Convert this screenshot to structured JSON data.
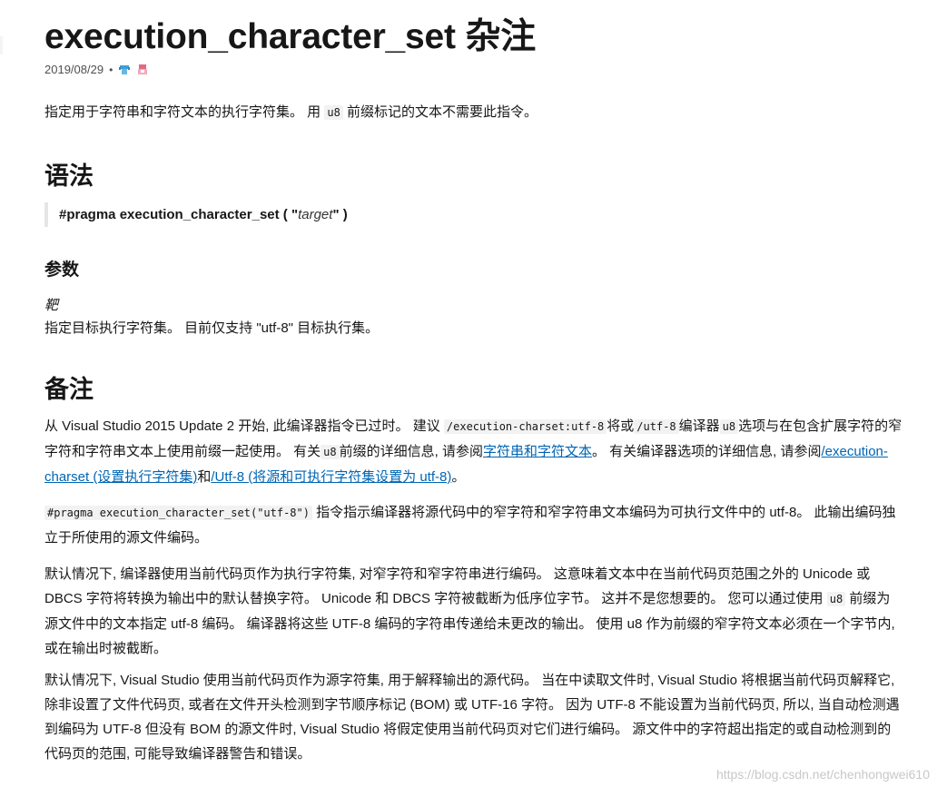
{
  "title": "execution_character_set 杂注",
  "meta": {
    "date": "2019/08/29",
    "separator": "•",
    "contributors": [
      "contributor-avatar-1",
      "contributor-avatar-2"
    ]
  },
  "intro": {
    "before": "指定用于字符串和字符文本的执行字符集。 用",
    "code": "u8",
    "after": " 前缀标记的文本不需要此指令。"
  },
  "syntax": {
    "heading": "语法",
    "pragma": "#pragma execution_character_set",
    "open": " ( \"",
    "target": "target",
    "close": "\" )"
  },
  "params": {
    "heading": "参数",
    "name": "靶",
    "desc": "指定目标执行字符集。 目前仅支持 \"utf-8\" 目标执行集。"
  },
  "remarks": {
    "heading": "备注",
    "p1": {
      "t1": "从 Visual Studio 2015 Update 2 开始, 此编译器指令已过时。 建议",
      "c1": "/execution-charset:utf-8",
      "t2": "将或",
      "c2": "/utf-8",
      "t3": "编译器",
      "c3": "u8",
      "t4": "选项与在包含扩展字符的窄字符和字符串文本上使用前缀一起使用。 有关",
      "c4": "u8",
      "t5": "前缀的详细信息, 请参阅",
      "link1": "字符串和字符文本",
      "t6": "。 有关编译器选项的详细信息, 请参阅",
      "link2": "/execution-charset (设置执行字符集)",
      "t7": "和",
      "link3": "/Utf-8 (将源和可执行字符集设置为 utf-8)",
      "t8": "。"
    },
    "p2": {
      "code": "#pragma execution_character_set(\"utf-8\")",
      "text": "指令指示编译器将源代码中的窄字符和窄字符串文本编码为可执行文件中的 utf-8。 此输出编码独立于所使用的源文件编码。"
    },
    "p3": {
      "t1": "默认情况下, 编译器使用当前代码页作为执行字符集, 对窄字符和窄字符串进行编码。 这意味着文本中在当前代码页范围之外的 Unicode 或 DBCS 字符将转换为输出中的默认替换字符。 Unicode 和 DBCS 字符被截断为低序位字节。 这并不是您想要的。 您可以通过使用",
      "code": "u8",
      "t2": "前缀为源文件中的文本指定 utf-8 编码。 编译器将这些 UTF-8 编码的字符串传递给未更改的输出。 使用 u8 作为前缀的窄字符文本必须在一个字节内, 或在输出时被截断。"
    },
    "p4": "默认情况下, Visual Studio 使用当前代码页作为源字符集, 用于解释输出的源代码。 当在中读取文件时, Visual Studio 将根据当前代码页解释它, 除非设置了文件代码页, 或者在文件开头检测到字节顺序标记 (BOM) 或 UTF-16 字符。 因为 UTF-8 不能设置为当前代码页, 所以, 当自动检测遇到编码为 UTF-8 但没有 BOM 的源文件时, Visual Studio 将假定使用当前代码页对它们进行编码。 源文件中的字符超出指定的或自动检测到的代码页的范围, 可能导致编译器警告和错误。"
  },
  "watermark": "https://blog.csdn.net/chenhongwei610"
}
